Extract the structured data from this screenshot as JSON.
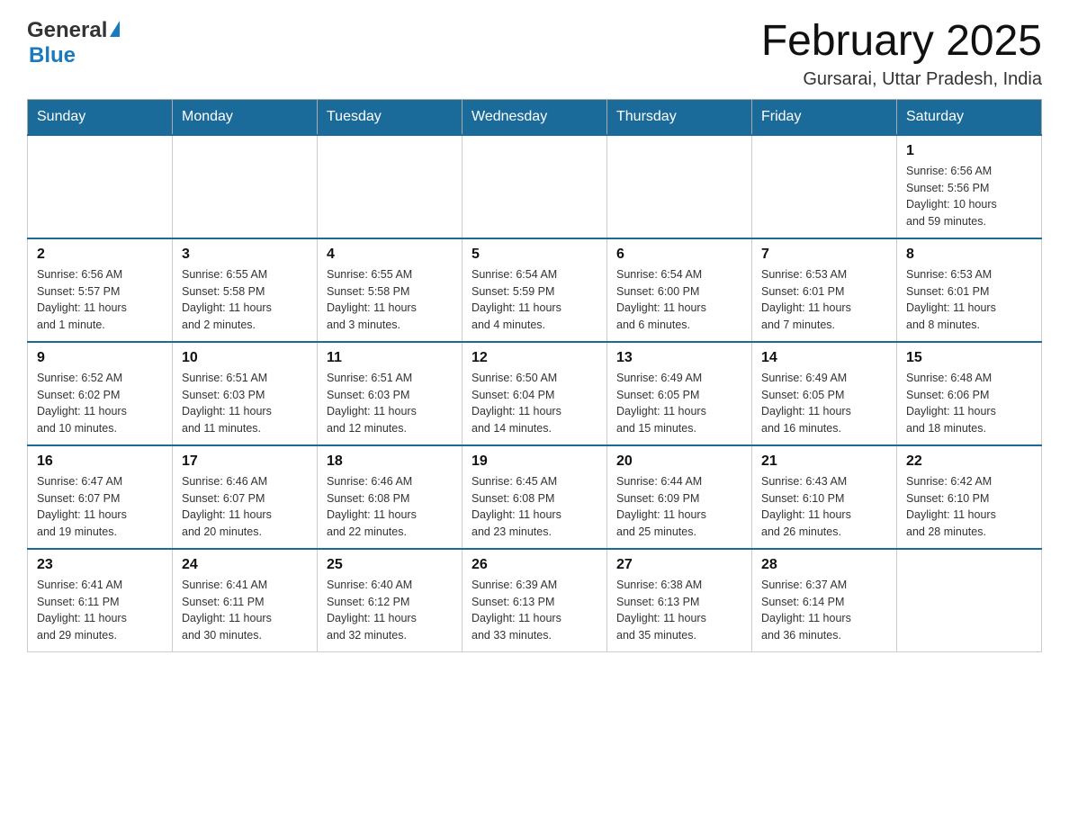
{
  "header": {
    "logo_line1": "General",
    "logo_line2": "Blue",
    "month_year": "February 2025",
    "location": "Gursarai, Uttar Pradesh, India"
  },
  "weekdays": [
    "Sunday",
    "Monday",
    "Tuesday",
    "Wednesday",
    "Thursday",
    "Friday",
    "Saturday"
  ],
  "weeks": [
    [
      {
        "day": "",
        "info": ""
      },
      {
        "day": "",
        "info": ""
      },
      {
        "day": "",
        "info": ""
      },
      {
        "day": "",
        "info": ""
      },
      {
        "day": "",
        "info": ""
      },
      {
        "day": "",
        "info": ""
      },
      {
        "day": "1",
        "info": "Sunrise: 6:56 AM\nSunset: 5:56 PM\nDaylight: 10 hours\nand 59 minutes."
      }
    ],
    [
      {
        "day": "2",
        "info": "Sunrise: 6:56 AM\nSunset: 5:57 PM\nDaylight: 11 hours\nand 1 minute."
      },
      {
        "day": "3",
        "info": "Sunrise: 6:55 AM\nSunset: 5:58 PM\nDaylight: 11 hours\nand 2 minutes."
      },
      {
        "day": "4",
        "info": "Sunrise: 6:55 AM\nSunset: 5:58 PM\nDaylight: 11 hours\nand 3 minutes."
      },
      {
        "day": "5",
        "info": "Sunrise: 6:54 AM\nSunset: 5:59 PM\nDaylight: 11 hours\nand 4 minutes."
      },
      {
        "day": "6",
        "info": "Sunrise: 6:54 AM\nSunset: 6:00 PM\nDaylight: 11 hours\nand 6 minutes."
      },
      {
        "day": "7",
        "info": "Sunrise: 6:53 AM\nSunset: 6:01 PM\nDaylight: 11 hours\nand 7 minutes."
      },
      {
        "day": "8",
        "info": "Sunrise: 6:53 AM\nSunset: 6:01 PM\nDaylight: 11 hours\nand 8 minutes."
      }
    ],
    [
      {
        "day": "9",
        "info": "Sunrise: 6:52 AM\nSunset: 6:02 PM\nDaylight: 11 hours\nand 10 minutes."
      },
      {
        "day": "10",
        "info": "Sunrise: 6:51 AM\nSunset: 6:03 PM\nDaylight: 11 hours\nand 11 minutes."
      },
      {
        "day": "11",
        "info": "Sunrise: 6:51 AM\nSunset: 6:03 PM\nDaylight: 11 hours\nand 12 minutes."
      },
      {
        "day": "12",
        "info": "Sunrise: 6:50 AM\nSunset: 6:04 PM\nDaylight: 11 hours\nand 14 minutes."
      },
      {
        "day": "13",
        "info": "Sunrise: 6:49 AM\nSunset: 6:05 PM\nDaylight: 11 hours\nand 15 minutes."
      },
      {
        "day": "14",
        "info": "Sunrise: 6:49 AM\nSunset: 6:05 PM\nDaylight: 11 hours\nand 16 minutes."
      },
      {
        "day": "15",
        "info": "Sunrise: 6:48 AM\nSunset: 6:06 PM\nDaylight: 11 hours\nand 18 minutes."
      }
    ],
    [
      {
        "day": "16",
        "info": "Sunrise: 6:47 AM\nSunset: 6:07 PM\nDaylight: 11 hours\nand 19 minutes."
      },
      {
        "day": "17",
        "info": "Sunrise: 6:46 AM\nSunset: 6:07 PM\nDaylight: 11 hours\nand 20 minutes."
      },
      {
        "day": "18",
        "info": "Sunrise: 6:46 AM\nSunset: 6:08 PM\nDaylight: 11 hours\nand 22 minutes."
      },
      {
        "day": "19",
        "info": "Sunrise: 6:45 AM\nSunset: 6:08 PM\nDaylight: 11 hours\nand 23 minutes."
      },
      {
        "day": "20",
        "info": "Sunrise: 6:44 AM\nSunset: 6:09 PM\nDaylight: 11 hours\nand 25 minutes."
      },
      {
        "day": "21",
        "info": "Sunrise: 6:43 AM\nSunset: 6:10 PM\nDaylight: 11 hours\nand 26 minutes."
      },
      {
        "day": "22",
        "info": "Sunrise: 6:42 AM\nSunset: 6:10 PM\nDaylight: 11 hours\nand 28 minutes."
      }
    ],
    [
      {
        "day": "23",
        "info": "Sunrise: 6:41 AM\nSunset: 6:11 PM\nDaylight: 11 hours\nand 29 minutes."
      },
      {
        "day": "24",
        "info": "Sunrise: 6:41 AM\nSunset: 6:11 PM\nDaylight: 11 hours\nand 30 minutes."
      },
      {
        "day": "25",
        "info": "Sunrise: 6:40 AM\nSunset: 6:12 PM\nDaylight: 11 hours\nand 32 minutes."
      },
      {
        "day": "26",
        "info": "Sunrise: 6:39 AM\nSunset: 6:13 PM\nDaylight: 11 hours\nand 33 minutes."
      },
      {
        "day": "27",
        "info": "Sunrise: 6:38 AM\nSunset: 6:13 PM\nDaylight: 11 hours\nand 35 minutes."
      },
      {
        "day": "28",
        "info": "Sunrise: 6:37 AM\nSunset: 6:14 PM\nDaylight: 11 hours\nand 36 minutes."
      },
      {
        "day": "",
        "info": ""
      }
    ]
  ]
}
